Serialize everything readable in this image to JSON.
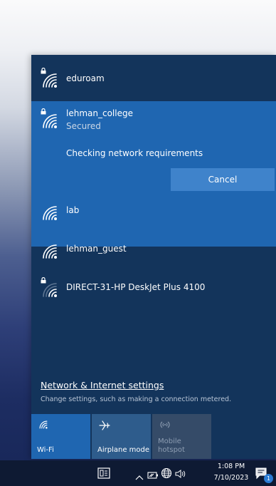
{
  "networks": [
    {
      "name": "eduroam",
      "secured": true
    },
    {
      "name": "lehman_college",
      "status": "Secured",
      "secured": true,
      "selected": true
    },
    {
      "name": "lab",
      "secured": false
    },
    {
      "name": "lehman_guest",
      "secured": false
    },
    {
      "name": "DIRECT-31-HP DeskJet Plus 4100",
      "secured": true
    }
  ],
  "connecting": {
    "message": "Checking network requirements",
    "cancel_label": "Cancel"
  },
  "settings": {
    "title": "Network & Internet settings",
    "description": "Change settings, such as making a connection metered."
  },
  "quick_actions": [
    {
      "label": "Wi-Fi",
      "icon": "wifi-icon",
      "state": "on"
    },
    {
      "label": "Airplane mode",
      "icon": "airplane-icon",
      "state": "off"
    },
    {
      "label": "Mobile hotspot",
      "icon": "hotspot-icon",
      "state": "disabled"
    }
  ],
  "taskbar": {
    "time": "1:08 PM",
    "date": "7/10/2023",
    "notification_count": "1"
  },
  "colors": {
    "flyout_bg": "#13345b",
    "selected_bg": "#1f66b1",
    "cancel_bg": "#3f83cb",
    "taskbar_bg": "#0e1a33"
  }
}
